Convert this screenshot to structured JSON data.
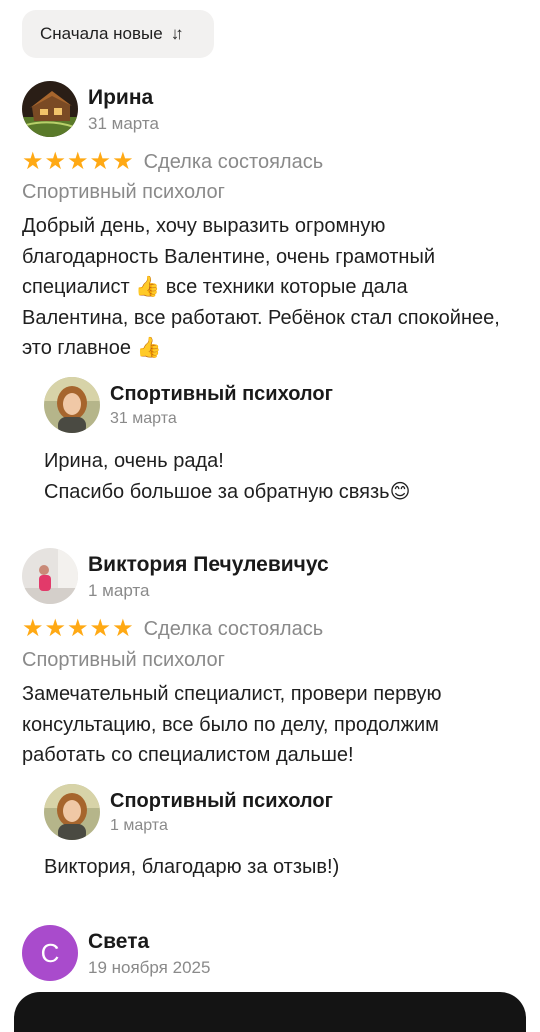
{
  "sort": {
    "label": "Сначала новые",
    "icon": "sort-arrows-icon"
  },
  "reviews": [
    {
      "author": "Ирина",
      "date": "31 марта",
      "stars": 5,
      "status": "Сделка состоялась",
      "service": "Спортивный психолог",
      "text": "Добрый день, хочу выразить огромную благодарность Валентине, очень грамотный специалист 👍 все техники которые дала Валентина, все работают. Ребёнок стал спокойнее, это главное 👍",
      "reply": {
        "author": "Спортивный психолог",
        "date": "31 марта",
        "text_line1": "Ирина, очень рада!",
        "text_line2": "Спасибо большое за обратную связь😊"
      }
    },
    {
      "author": "Виктория Печулевичус",
      "date": "1 марта",
      "stars": 5,
      "status": "Сделка состоялась",
      "service": "Спортивный психолог",
      "text": "Замечательный специалист, провери первую консультацию, все было по делу, продолжим работать со специалистом дальше!",
      "reply": {
        "author": "Спортивный психолог",
        "date": "1 марта",
        "text": "Виктория, благодарю за отзыв!)"
      }
    },
    {
      "author": "Света",
      "date": "19 ноября 2025",
      "avatar_letter": "С",
      "avatar_color": "#a94bcc"
    }
  ],
  "colors": {
    "star": "#ffa914",
    "muted": "#8a8a8a"
  }
}
